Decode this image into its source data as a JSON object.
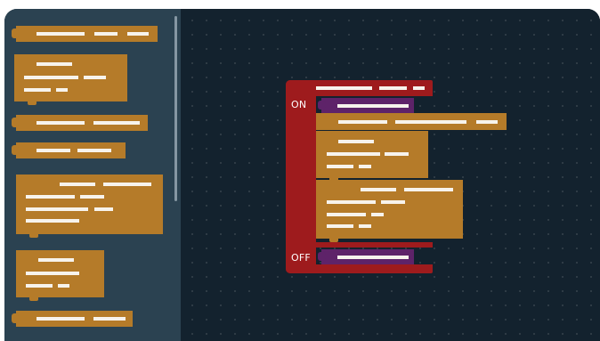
{
  "palette": {
    "event_block": "#b57b29",
    "condition_block": "#9e1b1d",
    "value_block": "#5e2369",
    "workspace_bg": "#13222e",
    "flyout_bg": "#2b4251"
  },
  "toggle_block": {
    "on_label": "ON",
    "off_label": "OFF"
  }
}
